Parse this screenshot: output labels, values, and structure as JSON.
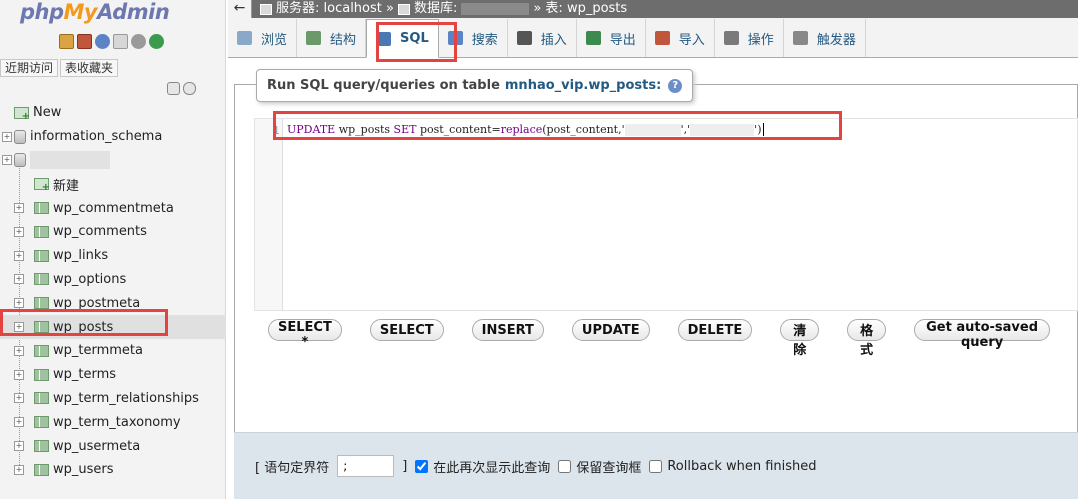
{
  "logo": {
    "php": "php",
    "my": "My",
    "admin": "Admin"
  },
  "nav": {
    "tabs": [
      "近期访问",
      "表收藏夹"
    ],
    "icons": [
      "home-icon",
      "exit-icon",
      "help-icon",
      "docs-icon",
      "settings-icon",
      "reload-icon"
    ],
    "tree": [
      {
        "label": "New",
        "type": "new",
        "level": 0
      },
      {
        "label": "information_schema",
        "type": "db",
        "level": 0
      },
      {
        "label": "",
        "type": "db-redacted",
        "level": 0
      },
      {
        "label": "新建",
        "type": "new",
        "level": 1
      },
      {
        "label": "wp_commentmeta",
        "type": "table",
        "level": 1
      },
      {
        "label": "wp_comments",
        "type": "table",
        "level": 1
      },
      {
        "label": "wp_links",
        "type": "table",
        "level": 1
      },
      {
        "label": "wp_options",
        "type": "table",
        "level": 1
      },
      {
        "label": "wp_postmeta",
        "type": "table",
        "level": 1
      },
      {
        "label": "wp_posts",
        "type": "table",
        "level": 1,
        "active": true
      },
      {
        "label": "wp_termmeta",
        "type": "table",
        "level": 1
      },
      {
        "label": "wp_terms",
        "type": "table",
        "level": 1
      },
      {
        "label": "wp_term_relationships",
        "type": "table",
        "level": 1
      },
      {
        "label": "wp_term_taxonomy",
        "type": "table",
        "level": 1
      },
      {
        "label": "wp_usermeta",
        "type": "table",
        "level": 1
      },
      {
        "label": "wp_users",
        "type": "table",
        "level": 1
      }
    ]
  },
  "topbar": {
    "back": "←",
    "server_label": "服务器: localhost »",
    "db_label": "数据库:",
    "table_label": "» 表: wp_posts"
  },
  "tabs": [
    {
      "label": "浏览",
      "icon": "browse-icon"
    },
    {
      "label": "结构",
      "icon": "structure-icon"
    },
    {
      "label": "SQL",
      "icon": "sql-icon",
      "active": true
    },
    {
      "label": "搜索",
      "icon": "search-icon"
    },
    {
      "label": "插入",
      "icon": "insert-icon"
    },
    {
      "label": "导出",
      "icon": "export-icon"
    },
    {
      "label": "导入",
      "icon": "import-icon"
    },
    {
      "label": "操作",
      "icon": "operations-icon"
    },
    {
      "label": "触发器",
      "icon": "triggers-icon"
    }
  ],
  "query": {
    "legend": "Run SQL query/queries on table",
    "table": "mnhao_vip.wp_posts:",
    "line_number": "1",
    "sql_kw1": "UPDATE",
    "sql_tbl": "wp_posts",
    "sql_kw2": "SET",
    "sql_col": "post_content=",
    "sql_fn": "replace",
    "sql_args_start": "(post_content,'",
    "sql_mid": "','",
    "sql_end": "')"
  },
  "buttons": [
    "SELECT *",
    "SELECT",
    "INSERT",
    "UPDATE",
    "DELETE",
    "清除",
    "格式",
    "Get auto-saved query"
  ],
  "footer": {
    "delimiter_label": "[ 语句定界符",
    "delimiter_value": ";",
    "delimiter_close": "]",
    "show_again": "在此再次显示此查询",
    "keep_box": "保留查询框",
    "rollback": "Rollback when finished",
    "show_again_checked": true,
    "keep_box_checked": false,
    "rollback_checked": false
  },
  "colors": {
    "accent": "#235a81",
    "highlight": "#e3443f",
    "footer_bg": "#dce4ec"
  }
}
